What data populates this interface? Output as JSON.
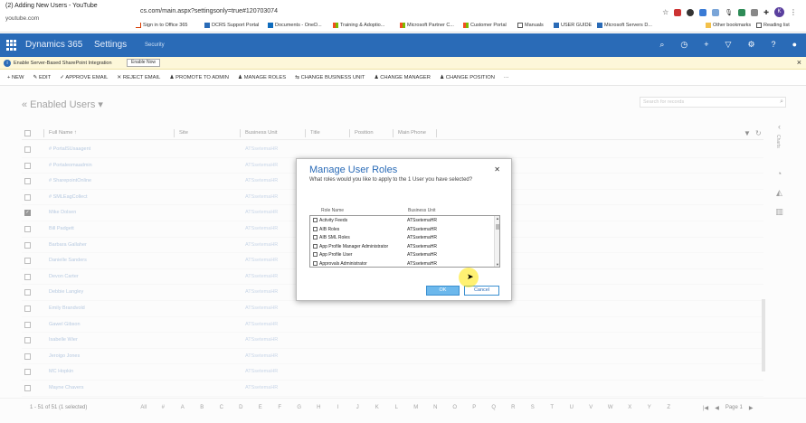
{
  "youtube": {
    "video_title": "(2) Adding New Users - YouTube",
    "source": "youtube.com"
  },
  "browser": {
    "url": "cs.com/main.aspx?settingsonly=true#120703074",
    "profile_initial": "K",
    "bookmarks": [
      {
        "label": "Sign in to Office 365"
      },
      {
        "label": "DCRS Support Portal"
      },
      {
        "label": "Documents - OneD..."
      },
      {
        "label": "Training & Adoptio..."
      },
      {
        "label": "Microsoft Partner C..."
      },
      {
        "label": "Customer Portal"
      },
      {
        "label": "Manuals"
      },
      {
        "label": "USER GUIDE"
      },
      {
        "label": "Microsoft Servers D..."
      },
      {
        "label": "Other bookmarks"
      },
      {
        "label": "Reading list"
      }
    ]
  },
  "navbar": {
    "app_name": "Dynamics 365",
    "area": "Settings",
    "sub": "Security"
  },
  "notification": {
    "message": "Enable Server-Based SharePoint Integration",
    "action": "Enable Now"
  },
  "commands": [
    "+ NEW",
    "✎ EDIT",
    "APPROVE EMAIL",
    "REJECT EMAIL",
    "PROMOTE TO ADMIN",
    "MANAGE ROLES",
    "CHANGE BUSINESS UNIT",
    "CHANGE MANAGER",
    "CHANGE POSITION",
    "···"
  ],
  "view": {
    "title": "« Enabled Users ▾",
    "search_placeholder": "Search for records"
  },
  "grid": {
    "columns": [
      "Full Name ↑",
      "Site",
      "Business Unit",
      "Title",
      "Position",
      "Main Phone"
    ],
    "rows": [
      {
        "name": "# PortalSUsaagent",
        "bu": "ATSsetemaHR",
        "selected": false
      },
      {
        "name": "# Portaleomaadmin",
        "bu": "ATSsetemaHR",
        "selected": false
      },
      {
        "name": "# SharepointOnline",
        "bu": "ATSsetemaHR",
        "selected": false
      },
      {
        "name": "# SMLEagCollect",
        "bu": "ATSsetemaHR",
        "selected": false
      },
      {
        "name": "Mike Dolsen",
        "bu": "ATSsetemaHR",
        "selected": true
      },
      {
        "name": "Bill Padgett",
        "bu": "ATSsetemaHR",
        "selected": false
      },
      {
        "name": "Barbara Gallaher",
        "bu": "ATSsetemaHR",
        "selected": false
      },
      {
        "name": "Danielle Sanders",
        "bu": "ATSsetemaHR",
        "selected": false
      },
      {
        "name": "Devon Carter",
        "bu": "ATSsetemaHR",
        "selected": false
      },
      {
        "name": "Debbie Langley",
        "bu": "ATSsetemaHR",
        "selected": false
      },
      {
        "name": "Emily Brandvold",
        "bu": "ATSsetemaHR",
        "selected": false
      },
      {
        "name": "Gawel Gibson",
        "bu": "ATSsetemaHR",
        "selected": false
      },
      {
        "name": "Isabelle Wier",
        "bu": "ATSsetemaHR",
        "selected": false
      },
      {
        "name": "Jeroigo Jones",
        "bu": "ATSsetemaHR",
        "selected": false
      },
      {
        "name": "MC Hopkin",
        "bu": "ATSsetemaHR",
        "selected": false
      },
      {
        "name": "Mayne Chavers",
        "bu": "ATSsetemaHR",
        "selected": false
      }
    ]
  },
  "footer": {
    "records": "1 - 51 of 51 (1 selected)",
    "letters": [
      "All",
      "#",
      "A",
      "B",
      "C",
      "D",
      "E",
      "F",
      "G",
      "H",
      "I",
      "J",
      "K",
      "L",
      "M",
      "N",
      "O",
      "P",
      "Q",
      "R",
      "S",
      "T",
      "U",
      "V",
      "W",
      "X",
      "Y",
      "Z"
    ],
    "page": "Page 1"
  },
  "dialog": {
    "title": "Manage User Roles",
    "subtitle": "What roles would you like to apply to the 1 User you have selected?",
    "col_role": "Role Name",
    "col_bu": "Business Unit",
    "roles": [
      {
        "name": "Activity Feeds",
        "bu": "ATSsetemaHR"
      },
      {
        "name": "AIB Roles",
        "bu": "ATSsetemaHR"
      },
      {
        "name": "AIB SML Roles",
        "bu": "ATSsetemaHR"
      },
      {
        "name": "App Profile Manager Administrator",
        "bu": "ATSsetemaHR"
      },
      {
        "name": "App Profile User",
        "bu": "ATSsetemaHR"
      },
      {
        "name": "Approvals Administrator",
        "bu": "ATSsetemaHR"
      }
    ],
    "ok": "OK",
    "cancel": "Cancel"
  },
  "colors": {
    "nav": "#2a6bb7",
    "accent": "#2a6bb7",
    "ok_button": "#6cb8ec"
  }
}
